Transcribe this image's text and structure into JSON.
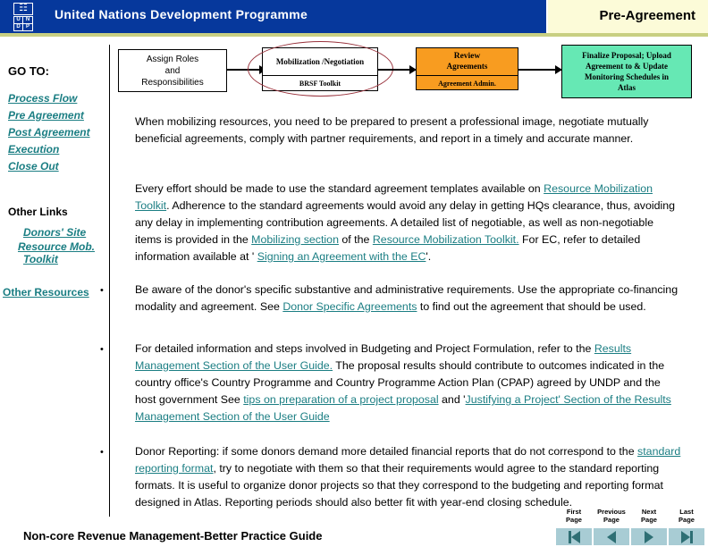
{
  "header": {
    "org_name": "United Nations Development Programme",
    "page_title": "Pre-Agreement",
    "logo_letters": [
      "U",
      "N",
      "D",
      "P"
    ],
    "globe_glyph": "☷",
    "brand_blue": "#06389c",
    "title_panel_bg": "#fcfbd8",
    "rule_color": "#c8cf82"
  },
  "sidebar": {
    "goto_label": "GO TO:",
    "nav_links": [
      {
        "label": "Process Flow"
      },
      {
        "label": "Pre Agreement"
      },
      {
        "label": "Post Agreement"
      },
      {
        "label": "Execution"
      },
      {
        "label": "Close Out"
      }
    ],
    "other_links_label": "Other Links",
    "other_links": [
      {
        "label": "Donors' Site"
      },
      {
        "label": "Resource Mob."
      },
      {
        "label": "Toolkit"
      }
    ],
    "other_resources_label": "Other Resources",
    "link_color": "#1b7e83"
  },
  "flowchart": {
    "box_assign": "Assign Roles and Responsibilities",
    "box_assign_lines": [
      "Assign Roles",
      "and",
      "Responsibilities"
    ],
    "box_mobilization_top": "Mobilization / Negotiation",
    "box_mobilization_top_lines": [
      "Mobilization /",
      "Negotiation"
    ],
    "box_mobilization_bottom": "BRSF Toolkit",
    "box_review_top_lines": [
      "Review",
      "Agreements"
    ],
    "box_review_bottom": "Agreement Admin.",
    "box_finalize_lines": [
      "Finalize Proposal; Upload",
      "Agreement to & Update",
      "Monitoring Schedules in",
      "Atlas"
    ],
    "colors": {
      "review_box": "#f89c20",
      "finalize_box": "#66e8b4",
      "highlight_ellipse": "#99323c"
    }
  },
  "content": {
    "para_intro": "When mobilizing resources, you need to be prepared to present a professional image, negotiate mutually beneficial agreements, comply with partner requirements, and report in a timely and accurate manner.",
    "para_effort": {
      "t1": "Every effort should be made to use the standard agreement templates available on ",
      "link1": "Resource Mobilization Toolkit",
      "t2": ".  Adherence to the standard agreements would avoid any delay in getting HQs clearance, thus, avoiding any delay in implementing contribution agreements.  A detailed list of negotiable, as well as non-negotiable items is provided in the ",
      "link2": "Mobilizing section",
      "t3": " of the ",
      "link3": "Resource Mobilization Toolkit.",
      "t4": " For EC, refer to detailed information available at ' ",
      "link4": "Signing an Agreement with the EC",
      "t5": "'."
    },
    "bullet_marker": "•",
    "bullet_1": {
      "t1": "Be aware of  the donor's specific substantive and administrative requirements. Use the appropriate co-financing modality and  agreement. See ",
      "link1": "Donor Specific Agreements",
      "t2": " to find out the agreement that should be used."
    },
    "bullet_2": {
      "t1": "For detailed information and steps involved in Budgeting and Project Formulation, refer to the ",
      "link1": "Results Management Section of the User Guide.",
      "t2": " The proposal results should contribute to outcomes  indicated in the country office's  Country Programme and Country Programme Action Plan (CPAP) agreed by UNDP and the host government  See ",
      "link2": "tips on preparation of a project proposal",
      "t3": "  and '",
      "link3": "Justifying  a Project' Section of the Results Management Section of the User Guide",
      "t4": ""
    },
    "bullet_3": {
      "t1": "Donor Reporting:  if some donors demand more detailed financial reports that do not correspond to the ",
      "link1": "standard reporting format",
      "t2": ", try to negotiate with them so that their requirements would agree to the standard reporting formats.  It is useful to organize donor projects so that they correspond to the budgeting and reporting format designed in Atlas.  Reporting periods should also better fit with year-end closing schedule."
    }
  },
  "footer": {
    "doc_title": "Non-core Revenue Management-Better Practice Guide",
    "pager": [
      {
        "line1": "First",
        "line2": "Page",
        "icon": "first-page-icon"
      },
      {
        "line1": "Previous",
        "line2": "Page",
        "icon": "previous-page-icon"
      },
      {
        "line1": "Next",
        "line2": "Page",
        "icon": "next-page-icon"
      },
      {
        "line1": "Last",
        "line2": "Page",
        "icon": "last-page-icon"
      }
    ],
    "pager_btn_bg": "#a8ccd4",
    "pager_arrow_color": "#2e6f74"
  }
}
